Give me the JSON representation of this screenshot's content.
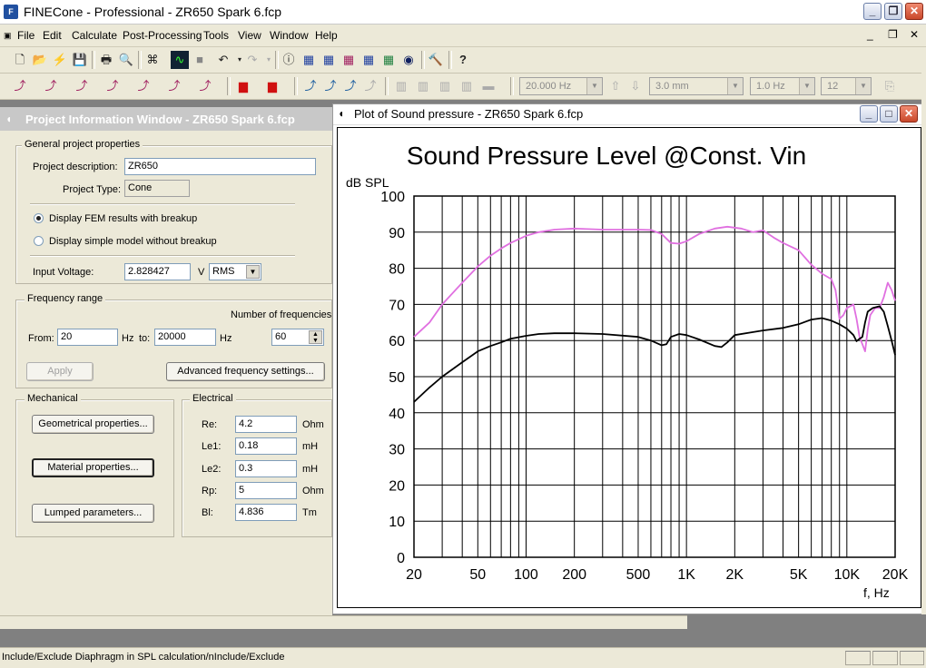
{
  "app": {
    "title": "FINECone - Professional - ZR650 Spark 6.fcp"
  },
  "menu": [
    "File",
    "Edit",
    "Calculate",
    "Post-Processing",
    "Tools",
    "View",
    "Window",
    "Help"
  ],
  "toolbar2": {
    "freq_value": "20.000 Hz",
    "mm_value": "3.0 mm",
    "hz_value": "1.0 Hz",
    "count_value": "12"
  },
  "project_window": {
    "title": "Project Information Window - ZR650 Spark 6.fcp",
    "general": {
      "legend": "General project properties",
      "description_label": "Project description:",
      "description_value": "ZR650",
      "type_label": "Project Type:",
      "type_value": "Cone",
      "radio_fem": "Display FEM results with breakup",
      "radio_simple": "Display simple model without breakup",
      "voltage_label": "Input Voltage:",
      "voltage_value": "2.828427",
      "voltage_unit": "V",
      "voltage_type": "RMS"
    },
    "frequency": {
      "legend": "Frequency range",
      "number_label": "Number of frequencies:",
      "from_label": "From:",
      "from_value": "20",
      "hz1": "Hz",
      "to_label": "to:",
      "to_value": "20000",
      "hz2": "Hz",
      "count_value": "60",
      "apply_label": "Apply",
      "advanced_label": "Advanced frequency settings..."
    },
    "mechanical": {
      "legend": "Mechanical",
      "geometrical_label": "Geometrical properties...",
      "material_label": "Material properties...",
      "lumped_label": "Lumped parameters..."
    },
    "electrical": {
      "legend": "Electrical",
      "rows": [
        {
          "label": "Re:",
          "value": "4.2",
          "unit": "Ohm"
        },
        {
          "label": "Le1:",
          "value": "0.18",
          "unit": "mH"
        },
        {
          "label": "Le2:",
          "value": "0.3",
          "unit": "mH"
        },
        {
          "label": "Rp:",
          "value": "5",
          "unit": "Ohm"
        },
        {
          "label": "Bl:",
          "value": "4.836",
          "unit": "Tm"
        }
      ]
    }
  },
  "plot_window": {
    "title": "Plot of Sound pressure - ZR650 Spark 6.fcp"
  },
  "chart_data": {
    "type": "line",
    "title": "Sound Pressure Level @Const. Vin",
    "ylabel": "dB SPL",
    "xlabel": "f, Hz",
    "xscale": "log",
    "xlim": [
      20,
      20000
    ],
    "ylim": [
      0,
      100
    ],
    "xticks": [
      {
        "v": 20,
        "label": "20"
      },
      {
        "v": 50,
        "label": "50"
      },
      {
        "v": 100,
        "label": "100"
      },
      {
        "v": 200,
        "label": "200"
      },
      {
        "v": 500,
        "label": "500"
      },
      {
        "v": 1000,
        "label": "1K"
      },
      {
        "v": 2000,
        "label": "2K"
      },
      {
        "v": 5000,
        "label": "5K"
      },
      {
        "v": 10000,
        "label": "10K"
      },
      {
        "v": 20000,
        "label": "20K"
      }
    ],
    "yticks": [
      0,
      10,
      20,
      30,
      40,
      50,
      60,
      70,
      80,
      90,
      100
    ],
    "grid": true,
    "series": [
      {
        "color": "#e070e0",
        "points": [
          [
            20,
            61
          ],
          [
            25,
            65
          ],
          [
            30,
            70
          ],
          [
            40,
            76
          ],
          [
            50,
            80.5
          ],
          [
            60,
            83.5
          ],
          [
            70,
            85.5
          ],
          [
            80,
            87
          ],
          [
            100,
            89
          ],
          [
            120,
            90
          ],
          [
            150,
            90.7
          ],
          [
            200,
            91
          ],
          [
            300,
            90.7
          ],
          [
            500,
            90.7
          ],
          [
            600,
            90.6
          ],
          [
            700,
            89.5
          ],
          [
            800,
            87
          ],
          [
            900,
            86.8
          ],
          [
            1000,
            87.5
          ],
          [
            1200,
            89.5
          ],
          [
            1500,
            91
          ],
          [
            1800,
            91.5
          ],
          [
            2200,
            91
          ],
          [
            2600,
            90
          ],
          [
            3000,
            90.5
          ],
          [
            3500,
            88.5
          ],
          [
            4000,
            87
          ],
          [
            5000,
            85
          ],
          [
            6000,
            81
          ],
          [
            7000,
            78.5
          ],
          [
            8000,
            77
          ],
          [
            8500,
            74
          ],
          [
            9000,
            66
          ],
          [
            9500,
            67
          ],
          [
            10000,
            69
          ],
          [
            11000,
            70
          ],
          [
            11500,
            66
          ],
          [
            12000,
            61
          ],
          [
            12500,
            59
          ],
          [
            13000,
            57
          ],
          [
            13500,
            63
          ],
          [
            14000,
            67
          ],
          [
            15000,
            69
          ],
          [
            16000,
            69
          ],
          [
            17000,
            72
          ],
          [
            18000,
            76
          ],
          [
            19000,
            74
          ],
          [
            20000,
            71
          ]
        ]
      },
      {
        "color": "#000000",
        "points": [
          [
            20,
            43
          ],
          [
            25,
            47
          ],
          [
            30,
            50
          ],
          [
            40,
            54
          ],
          [
            50,
            57
          ],
          [
            60,
            58.5
          ],
          [
            70,
            59.5
          ],
          [
            80,
            60.5
          ],
          [
            100,
            61.3
          ],
          [
            120,
            61.8
          ],
          [
            150,
            62
          ],
          [
            200,
            62
          ],
          [
            300,
            61.8
          ],
          [
            500,
            61
          ],
          [
            600,
            60
          ],
          [
            700,
            58.7
          ],
          [
            750,
            59
          ],
          [
            800,
            61
          ],
          [
            900,
            61.8
          ],
          [
            1000,
            61.5
          ],
          [
            1200,
            60.3
          ],
          [
            1500,
            58.5
          ],
          [
            1650,
            58.2
          ],
          [
            1800,
            59.5
          ],
          [
            2000,
            61.5
          ],
          [
            2500,
            62.2
          ],
          [
            3000,
            62.8
          ],
          [
            4000,
            63.5
          ],
          [
            5000,
            64.5
          ],
          [
            6000,
            65.8
          ],
          [
            7000,
            66.2
          ],
          [
            8000,
            65.5
          ],
          [
            9000,
            64.5
          ],
          [
            10000,
            63.3
          ],
          [
            11000,
            61.5
          ],
          [
            11500,
            59.8
          ],
          [
            12000,
            60.5
          ],
          [
            12500,
            61
          ],
          [
            13000,
            65
          ],
          [
            13500,
            68
          ],
          [
            14500,
            69
          ],
          [
            16000,
            69.5
          ],
          [
            17000,
            68
          ],
          [
            18000,
            64
          ],
          [
            19000,
            60
          ],
          [
            20000,
            56
          ]
        ]
      }
    ]
  },
  "status": {
    "text": "Include/Exclude Diaphragm in SPL calculation/nInclude/Exclude"
  }
}
